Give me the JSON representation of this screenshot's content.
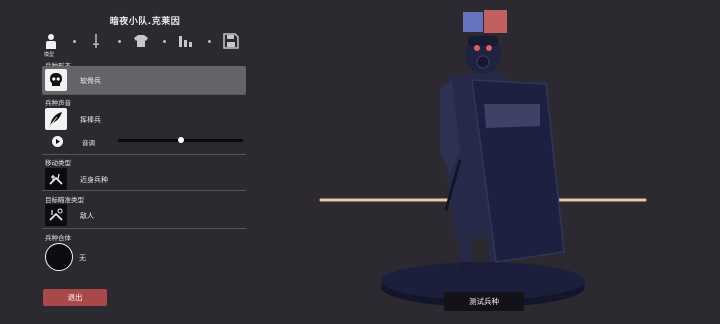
{
  "unit_title": "暗夜小队.克莱因",
  "tabs": [
    {
      "icon": "person-icon",
      "active": true
    },
    {
      "icon": "sword-icon",
      "active": false
    },
    {
      "icon": "shirt-icon",
      "active": false
    },
    {
      "icon": "stats-icon",
      "active": false
    },
    {
      "icon": "save-icon",
      "active": false
    }
  ],
  "active_tab_label": "模型",
  "sections": {
    "unit_form": {
      "label": "兵种形态",
      "value": "软骨兵",
      "icon": "skull-icon"
    },
    "unit_voice": {
      "label": "兵种声音",
      "value": "挥棒兵",
      "icon": "feather-icon",
      "pitch_label": "音调",
      "pitch_level": 0.5
    },
    "movement_type": {
      "label": "移动类型",
      "value": "近身兵种",
      "icon": "movement-icon"
    },
    "target_type": {
      "label": "目标瞄准类型",
      "value": "敌人",
      "icon": "target-icon"
    },
    "unit_merge": {
      "label": "兵种合体",
      "value": "无"
    }
  },
  "exit_label": "退出",
  "test_label": "测试兵种",
  "team_colors": {
    "blue": "#6873c0",
    "red": "#c06060"
  },
  "colors": {
    "background": "#2c2a30",
    "selected_row": "#66646a",
    "exit": "#a94848",
    "unit_dark": "#1c1f3b"
  }
}
